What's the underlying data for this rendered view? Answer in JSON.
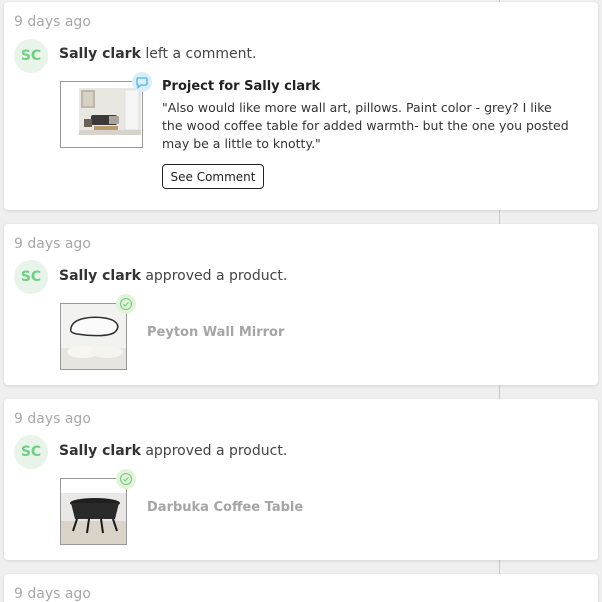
{
  "colors": {
    "avatar_bg": "#e8f4ea",
    "avatar_text": "#6fcf83",
    "timestamp": "#a8a8a8",
    "approved_badge": "#e3f3d9",
    "comment_badge": "#d9eef8"
  },
  "feed": [
    {
      "timestamp": "9 days ago",
      "avatar_initials": "SC",
      "user_name": "Sally clark",
      "action": " left a comment.",
      "badge_icon": "comment-bubble-icon",
      "comment_title": "Project for Sally clark",
      "comment_text": "\"Also would like more wall art, pillows. Paint color - grey? I like the wood coffee table for added warmth- but the one you posted may be a little to knotty.\"",
      "button_label": "See Comment"
    },
    {
      "timestamp": "9 days ago",
      "avatar_initials": "SC",
      "user_name": "Sally clark",
      "action": " approved a product.",
      "badge_icon": "check-circle-icon",
      "product_name": "Peyton Wall Mirror"
    },
    {
      "timestamp": "9 days ago",
      "avatar_initials": "SC",
      "user_name": "Sally clark",
      "action": " approved a product.",
      "badge_icon": "check-circle-icon",
      "product_name": "Darbuka Coffee Table"
    },
    {
      "timestamp": "9 days ago"
    }
  ]
}
